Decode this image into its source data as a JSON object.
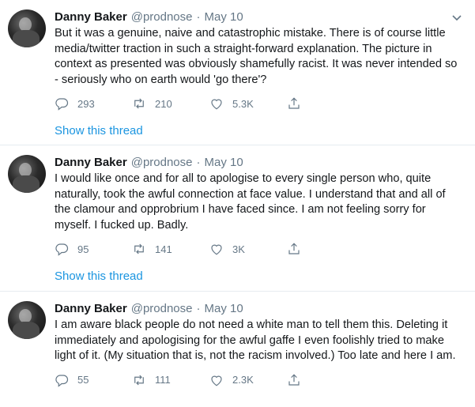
{
  "tweets": [
    {
      "name": "Danny Baker",
      "handle": "@prodnose",
      "separator": "·",
      "date": "May 10",
      "text": "But it was a genuine, naive and catastrophic mistake. There is of course little media/twitter traction in such a straight-forward explanation. The picture in context as presented was obviously shamefully racist. It was never intended so - seriously who on earth would 'go there'?",
      "replies": "293",
      "retweets": "210",
      "likes": "5.3K",
      "thread_link": "Show this thread"
    },
    {
      "name": "Danny Baker",
      "handle": "@prodnose",
      "separator": "·",
      "date": "May 10",
      "text": "I would like once and for all to apologise to every single person who, quite naturally, took the awful connection at face value. I understand that and all of the clamour and opprobrium I have faced since. I am not feeling sorry for myself. I fucked up. Badly.",
      "replies": "95",
      "retweets": "141",
      "likes": "3K",
      "thread_link": "Show this thread"
    },
    {
      "name": "Danny Baker",
      "handle": "@prodnose",
      "separator": "·",
      "date": "May 10",
      "text": "I am aware black people do not need a white man to tell them this. Deleting it immediately and apologising for the awful gaffe I even foolishly tried to make light of it. (My situation that is, not the racism involved.) Too late and here I am.",
      "replies": "55",
      "retweets": "111",
      "likes": "2.3K"
    }
  ],
  "colors": {
    "text": "#14171a",
    "secondary": "#657786",
    "link": "#1b95e0",
    "divider": "#e6ecf0"
  },
  "icons": [
    "chevron-down-icon",
    "reply-icon",
    "retweet-icon",
    "like-icon",
    "share-icon"
  ]
}
